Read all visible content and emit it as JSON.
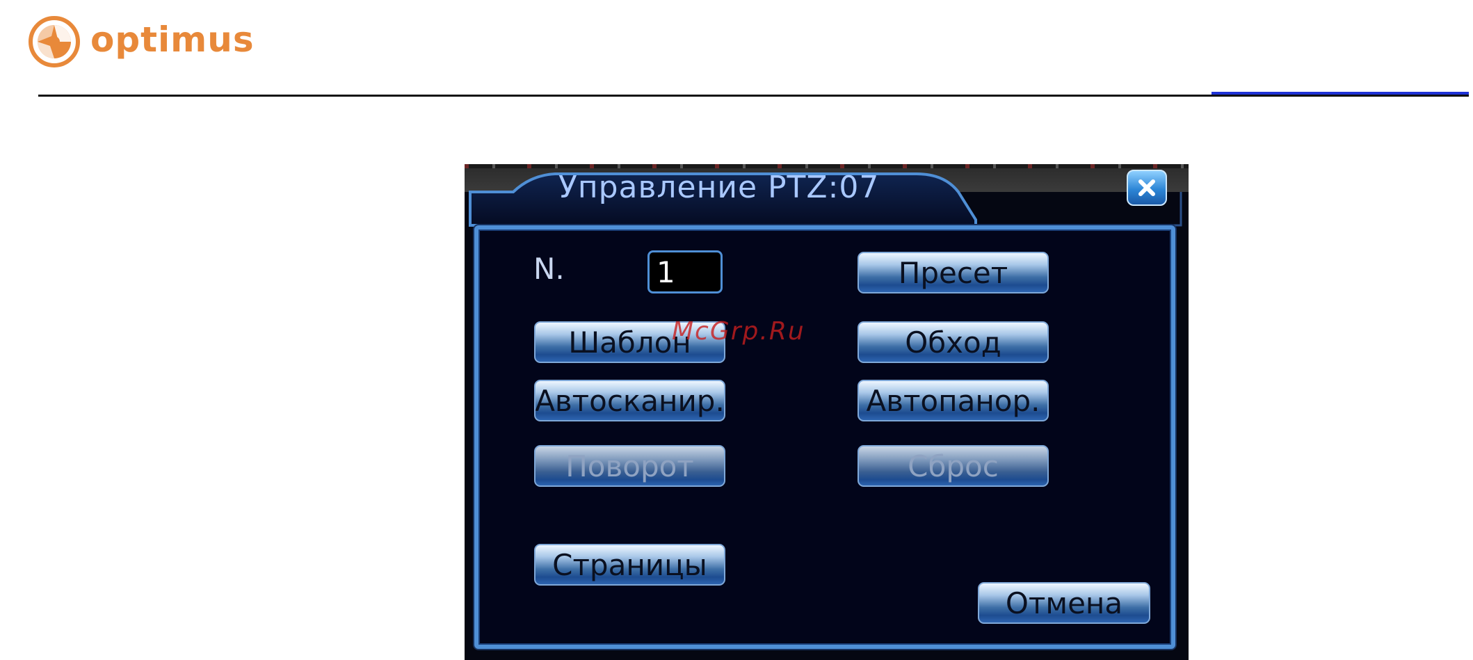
{
  "header": {
    "brand_name": "optimus",
    "brand_color": "#e8893a",
    "logo_icon": "aperture-icon"
  },
  "dialog": {
    "title": "Управление PTZ:07",
    "close_icon": "close-icon",
    "number_label": "N.",
    "number_value": "1",
    "buttons": {
      "preset": "Пресет",
      "pattern": "Шаблон",
      "tour": "Обход",
      "autoscan": "Автосканир.",
      "autopan": "Автопанор.",
      "rotate": "Поворот",
      "reset": "Сброс",
      "pages": "Страницы",
      "cancel": "Отмена"
    },
    "colors": {
      "panel_border": "#4f8fd6",
      "title_text": "#a9c8ff",
      "background": "#02051a"
    }
  },
  "watermark": "McGrp.Ru"
}
